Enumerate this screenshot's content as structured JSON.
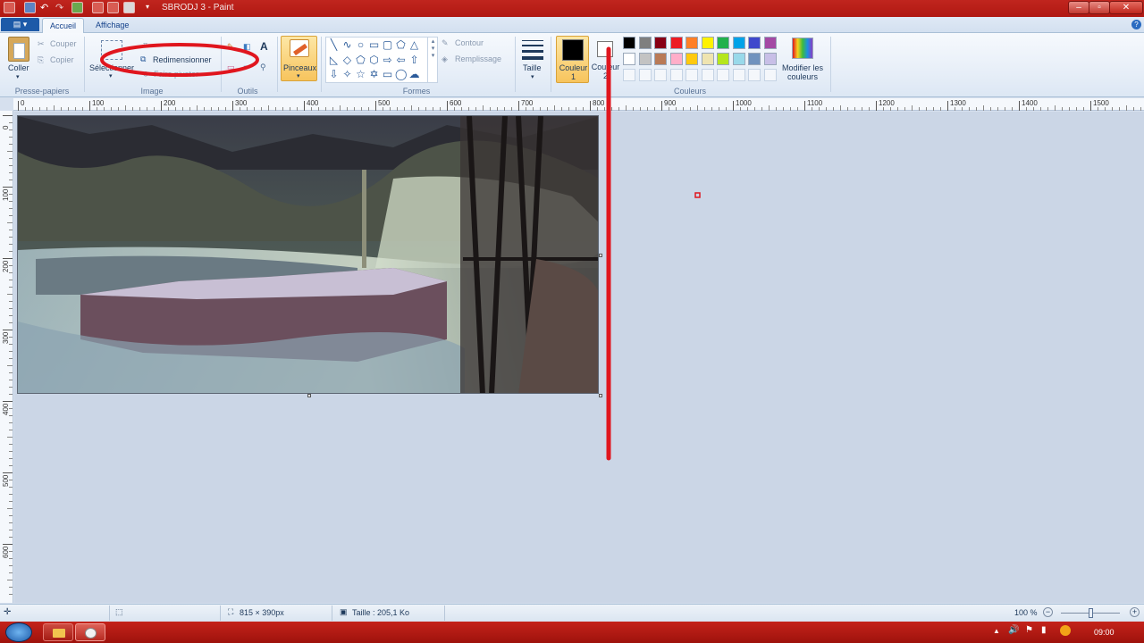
{
  "window": {
    "title": "SBRODJ 3 - Paint"
  },
  "tabs": {
    "file_icon": "menu-icon",
    "accueil": "Accueil",
    "affichage": "Affichage"
  },
  "clipboard": {
    "paste": "Coller",
    "cut": "Couper",
    "copy": "Copier",
    "group": "Presse-papiers"
  },
  "image_group": {
    "select": "Sélectionner",
    "resize": "Redimensionner",
    "rotate": "Faire pivoter",
    "group": "Image"
  },
  "tools": {
    "group": "Outils",
    "text_glyph": "A"
  },
  "brushes": {
    "label": "Pinceaux"
  },
  "shapes": {
    "outline": "Contour",
    "fill": "Remplissage",
    "group": "Formes"
  },
  "size": {
    "label": "Taille"
  },
  "colors": {
    "color1": "Couleur\n1",
    "color2": "Couleur\n2",
    "edit": "Modifier les\ncouleurs",
    "group": "Couleurs",
    "row1": [
      "#000000",
      "#7f7f7f",
      "#880015",
      "#ed1c24",
      "#ff7f27",
      "#fff200",
      "#22b14c",
      "#00a2e8",
      "#3f48cc",
      "#a349a4"
    ],
    "row2": [
      "#ffffff",
      "#c3c3c3",
      "#b97a57",
      "#ffaec9",
      "#ffc90e",
      "#efe4b0",
      "#b5e61d",
      "#99d9ea",
      "#7092be",
      "#c8bfe7"
    ]
  },
  "ruler": {
    "h_ticks": [
      "0",
      "100",
      "200",
      "300",
      "400",
      "500",
      "600",
      "700",
      "800",
      "900",
      "1000",
      "1100",
      "1200",
      "1300",
      "1400",
      "1500"
    ],
    "v_ticks": [
      "0",
      "100",
      "200",
      "300",
      "400",
      "500",
      "600"
    ]
  },
  "status": {
    "dimensions": "815 × 390px",
    "size": "Taille : 205,1 Ko",
    "zoom": "100 %"
  },
  "taskbar": {
    "time": "09:00"
  },
  "accent": {
    "title_red": "#b81a14",
    "annotation_red": "#e0161e"
  }
}
